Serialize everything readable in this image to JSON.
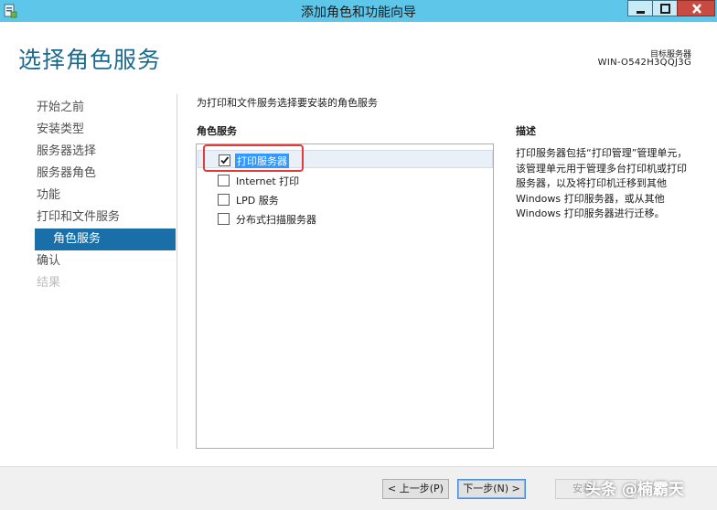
{
  "window": {
    "title": "添加角色和功能向导",
    "app_icon": "server-manager-icon",
    "controls": [
      "minimize-icon",
      "maximize-icon",
      "close-icon"
    ],
    "title_bar_color": "#5ec6e8"
  },
  "header": {
    "page_title": "选择角色服务",
    "target_server_label": "目标服务器",
    "target_server_name": "WIN-O542H3QQJ3G"
  },
  "nav": {
    "items": [
      {
        "label": "开始之前",
        "state": "normal"
      },
      {
        "label": "安装类型",
        "state": "normal"
      },
      {
        "label": "服务器选择",
        "state": "normal"
      },
      {
        "label": "服务器角色",
        "state": "normal"
      },
      {
        "label": "功能",
        "state": "normal"
      },
      {
        "label": "打印和文件服务",
        "state": "normal"
      },
      {
        "label": "角色服务",
        "state": "active"
      },
      {
        "label": "确认",
        "state": "normal"
      },
      {
        "label": "结果",
        "state": "disabled"
      }
    ],
    "active_color": "#1a6fa8"
  },
  "main": {
    "instruction": "为打印和文件服务选择要安装的角色服务",
    "roles_heading": "角色服务",
    "roles": [
      {
        "label": "打印服务器",
        "checked": true,
        "selected": true
      },
      {
        "label": "Internet 打印",
        "checked": false,
        "selected": false
      },
      {
        "label": "LPD 服务",
        "checked": false,
        "selected": false
      },
      {
        "label": "分布式扫描服务器",
        "checked": false,
        "selected": false
      }
    ]
  },
  "description": {
    "heading": "描述",
    "text": "打印服务器包括“打印管理”管理单元，该管理单元用于管理多台打印机或打印服务器，以及将打印机迁移到其他 Windows 打印服务器，或从其他 Windows 打印服务器进行迁移。"
  },
  "footer": {
    "prev_label": "< 上一步(P)",
    "next_label": "下一步(N) >",
    "install_label": "安装"
  },
  "overlay": {
    "watermark": "头条 @楠霸天",
    "annotation_color": "#e23b3b"
  }
}
